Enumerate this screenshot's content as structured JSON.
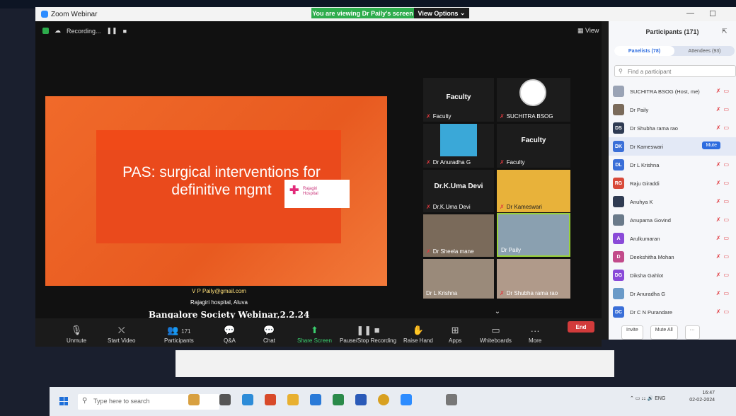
{
  "window": {
    "title": "Zoom Webinar",
    "viewing_banner": "You are viewing Dr Paily's screen",
    "view_options": "View Options"
  },
  "stage": {
    "recording": "Recording...",
    "view_label": "View"
  },
  "slide": {
    "title": "PAS: surgical interventions for definitive mgmt",
    "logo_text": "Rajagiri Hospital",
    "email": "V P Paily@gmail.com",
    "hospital": "Rajagiri hospital, Aluva",
    "event": "Bangalore Society Webinar,2.2.24"
  },
  "tiles": [
    {
      "name": "",
      "big": "Faculty"
    },
    {
      "name": "SUCHITRA BSOG",
      "big": ""
    },
    {
      "name": "Faculty",
      "big": ""
    },
    {
      "name": "Faculty",
      "big": "Faculty"
    },
    {
      "name": "Dr Anuradha G",
      "big": ""
    },
    {
      "name": "Dr Kameswari",
      "big": ""
    },
    {
      "name": "Dr.K.Uma Devi",
      "big": "Dr.K.Uma Devi"
    },
    {
      "name": "Dr Sheela mane",
      "big": ""
    },
    {
      "name": "Dr Paily",
      "big": ""
    },
    {
      "name": "Dr L Krishna",
      "big": ""
    },
    {
      "name": "Dr Shubha rama rao",
      "big": ""
    }
  ],
  "sidebar": {
    "title": "Participants (171)",
    "tabs": [
      "Panelists (78)",
      "Attendees (93)"
    ],
    "search_placeholder": "Find a participant",
    "participants": [
      {
        "initials": "",
        "name": "SUCHITRA BSOG (Host, me)",
        "color": "#9aa3b5"
      },
      {
        "initials": "",
        "name": "Dr Paily",
        "color": "#7a6a5a"
      },
      {
        "initials": "DS",
        "name": "Dr Shubha rama rao",
        "color": "#2f3b52"
      },
      {
        "initials": "DK",
        "name": "Dr Kameswari",
        "color": "#3a6fd8"
      },
      {
        "initials": "DL",
        "name": "Dr L Krishna",
        "color": "#3a6fd8"
      },
      {
        "initials": "RG",
        "name": "Raju Giraddi",
        "color": "#d84a3a"
      },
      {
        "initials": "",
        "name": "Anuhya K",
        "color": "#2f3b52"
      },
      {
        "initials": "",
        "name": "Anupama Govind",
        "color": "#6a7a8a"
      },
      {
        "initials": "A",
        "name": "Arulkumaran",
        "color": "#8a4ad8"
      },
      {
        "initials": "D",
        "name": "Deekshitha Mohan",
        "color": "#c24a8a"
      },
      {
        "initials": "DG",
        "name": "Diksha Gahlot",
        "color": "#8a4ad8"
      },
      {
        "initials": "",
        "name": "Dr Anuradha G",
        "color": "#6a9ac8"
      },
      {
        "initials": "DC",
        "name": "Dr C N Purandare",
        "color": "#3a6fd8"
      }
    ],
    "mute_label": "Mute",
    "invite": "Invite",
    "mute_all": "Mute All"
  },
  "toolbar": {
    "unmute": "Unmute",
    "start_video": "Start Video",
    "participants": "Participants",
    "participants_count": "171",
    "qa": "Q&A",
    "chat": "Chat",
    "share_screen": "Share Screen",
    "pause_rec": "Pause/Stop Recording",
    "raise_hand": "Raise Hand",
    "apps": "Apps",
    "whiteboards": "Whiteboards",
    "more": "More",
    "end": "End"
  },
  "taskbar": {
    "search_placeholder": "Type here to search",
    "time": "16:47",
    "date": "02-02-2024",
    "lang": "ENG"
  }
}
